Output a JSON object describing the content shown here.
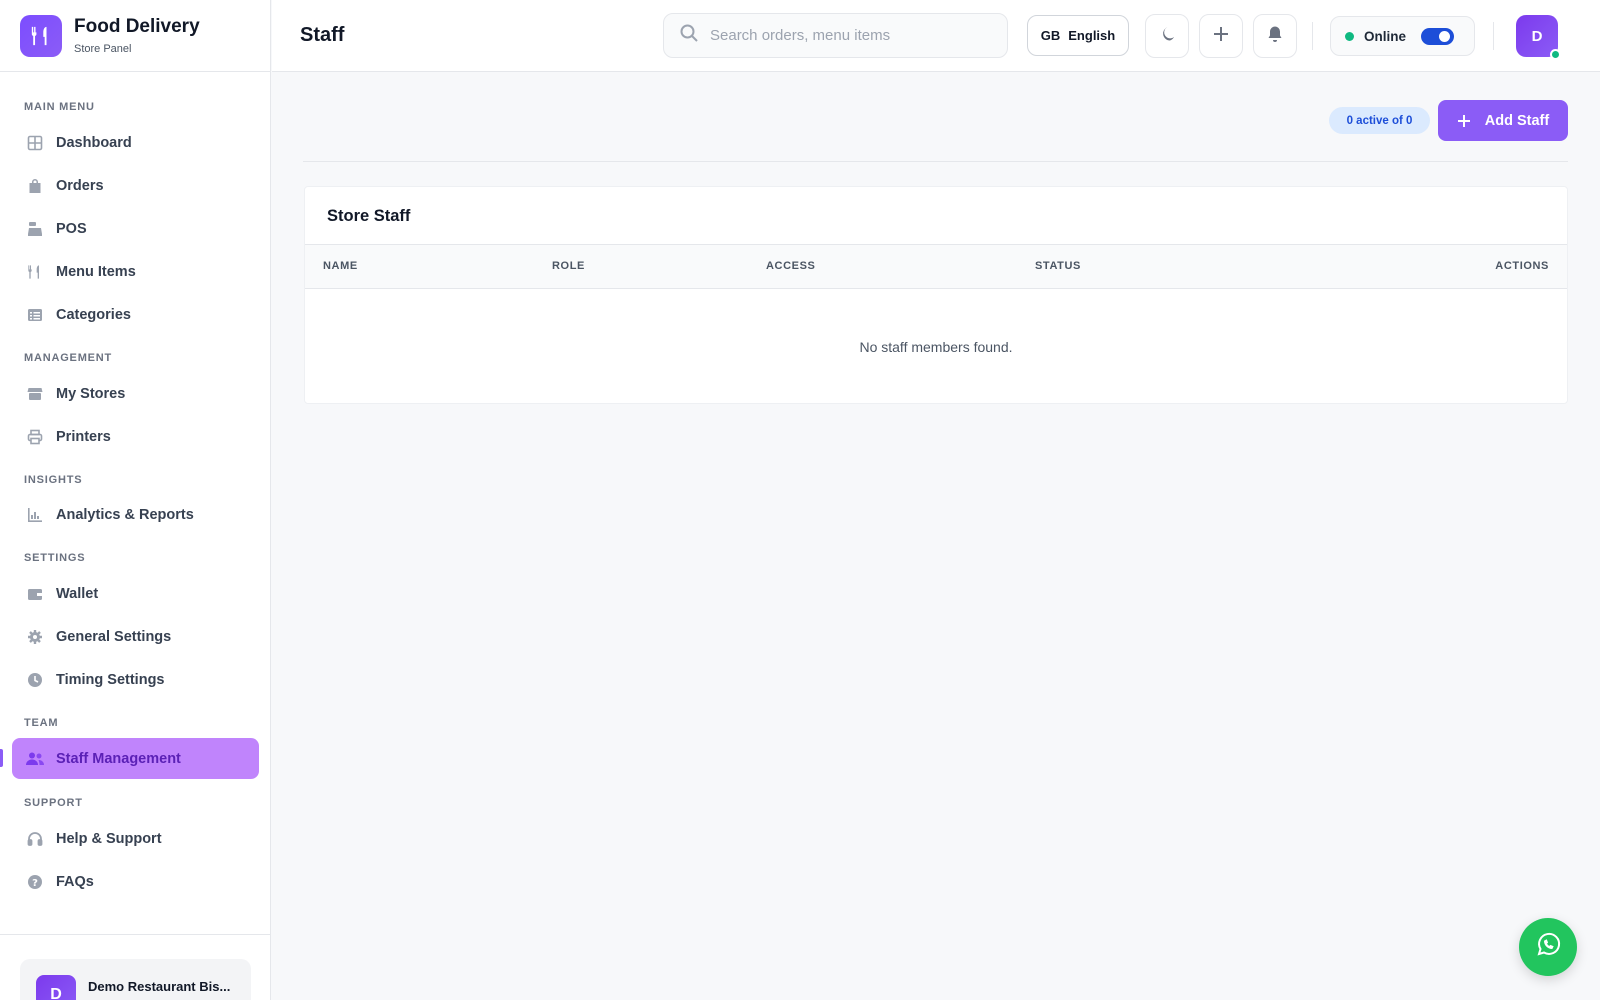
{
  "brand": {
    "title": "Food Delivery",
    "subtitle": "Store Panel"
  },
  "sidebar": {
    "sections": [
      {
        "label": "MAIN MENU"
      },
      {
        "label": "MANAGEMENT"
      },
      {
        "label": "INSIGHTS"
      },
      {
        "label": "SETTINGS"
      },
      {
        "label": "TEAM"
      },
      {
        "label": "SUPPORT"
      }
    ],
    "items": [
      {
        "label": "Dashboard",
        "icon": "grid-icon"
      },
      {
        "label": "Orders",
        "icon": "shopping-bag-icon"
      },
      {
        "label": "POS",
        "icon": "cash-register-icon"
      },
      {
        "label": "Menu Items",
        "icon": "utensils-icon"
      },
      {
        "label": "Categories",
        "icon": "list-icon"
      },
      {
        "label": "My Stores",
        "icon": "store-icon"
      },
      {
        "label": "Printers",
        "icon": "printer-icon"
      },
      {
        "label": "Analytics & Reports",
        "icon": "chart-icon"
      },
      {
        "label": "Wallet",
        "icon": "wallet-icon"
      },
      {
        "label": "General Settings",
        "icon": "gear-icon"
      },
      {
        "label": "Timing Settings",
        "icon": "clock-icon"
      },
      {
        "label": "Staff Management",
        "icon": "users-icon",
        "active": true
      },
      {
        "label": "Help & Support",
        "icon": "headset-icon"
      },
      {
        "label": "FAQs",
        "icon": "question-icon"
      }
    ],
    "store": {
      "avatar": "D",
      "name": "Demo Restaurant Bis..."
    }
  },
  "header": {
    "title": "Staff",
    "search_placeholder": "Search orders, menu items",
    "language_code": "GB",
    "language": "English",
    "status_label": "Online",
    "user_initial": "D"
  },
  "main": {
    "count_badge": "0 active of 0",
    "add_button": "Add Staff",
    "card_title": "Store Staff",
    "columns": [
      "NAME",
      "ROLE",
      "ACCESS",
      "STATUS",
      "ACTIONS"
    ],
    "empty_message": "No staff members found."
  },
  "colors": {
    "accent": "#8b5cf6",
    "active_nav_bg": "#c084fc",
    "online": "#10b981",
    "whatsapp": "#22c55e"
  }
}
